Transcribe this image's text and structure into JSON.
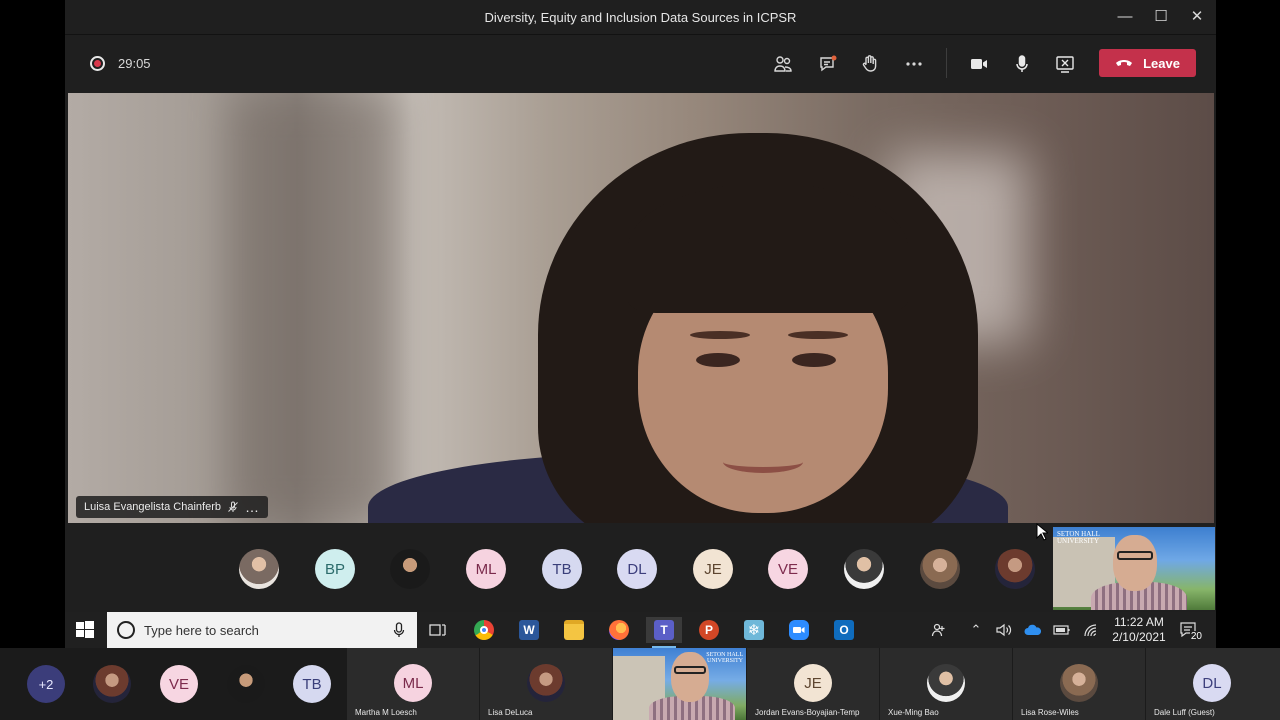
{
  "window": {
    "title": "Diversity, Equity and Inclusion Data Sources in ICPSR"
  },
  "call": {
    "timer": "29:05",
    "leave_label": "Leave"
  },
  "main_video": {
    "speaker_name": "Luisa Evangelista Chainferb"
  },
  "participants_strip": [
    {
      "initials": ""
    },
    {
      "initials": "BP",
      "bg": "#cfeeee",
      "fg": "#2b6b6b"
    },
    {
      "initials": ""
    },
    {
      "initials": "ML",
      "bg": "#f6d3e0",
      "fg": "#7a2a4b"
    },
    {
      "initials": "TB",
      "bg": "#d6d9f0",
      "fg": "#3a3f7a"
    },
    {
      "initials": "DL",
      "bg": "#d9daf2",
      "fg": "#3d3f7d"
    },
    {
      "initials": "JE",
      "bg": "#f2e4d3",
      "fg": "#5e4630"
    },
    {
      "initials": "VE",
      "bg": "#f7d6e2",
      "fg": "#7d2b4d"
    },
    {
      "initials": ""
    },
    {
      "initials": ""
    },
    {
      "initials": ""
    }
  ],
  "taskbar": {
    "search_placeholder": "Type here to search",
    "time": "11:22 AM",
    "date": "2/10/2021",
    "notification_count": "20",
    "apps": [
      "task-view",
      "chrome",
      "word",
      "file-explorer",
      "firefox",
      "teams",
      "powerpoint",
      "snowflake",
      "zoom",
      "outlook"
    ]
  },
  "gallery": {
    "overflow_label": "+2",
    "small": [
      {
        "initials": ""
      },
      {
        "initials": "VE",
        "bg": "#f7d6e2",
        "fg": "#7d2b4d"
      },
      {
        "initials": ""
      },
      {
        "initials": "TB",
        "bg": "#d6d9f0",
        "fg": "#3a3f7a"
      }
    ],
    "tiles": [
      {
        "initials": "ML",
        "name": "Martha M Loesch",
        "bg": "#f6d3e0",
        "fg": "#7a2a4b"
      },
      {
        "initials": "",
        "name": "Lisa DeLuca"
      },
      {
        "initials": "JE",
        "name": "Jordan Evans-Boyajian-Temp",
        "bg": "#f2e4d3",
        "fg": "#5e4630"
      },
      {
        "initials": "",
        "name": "Xue-Ming Bao"
      },
      {
        "initials": "",
        "name": "Lisa Rose-Wiles"
      },
      {
        "initials": "DL",
        "name": "Dale Luff (Guest)",
        "bg": "#d9daf2",
        "fg": "#3d3f7d"
      }
    ]
  },
  "colors": {
    "leave": "#c4314b",
    "record": "#d9374b",
    "teams_bg": "#1f1f1f"
  }
}
